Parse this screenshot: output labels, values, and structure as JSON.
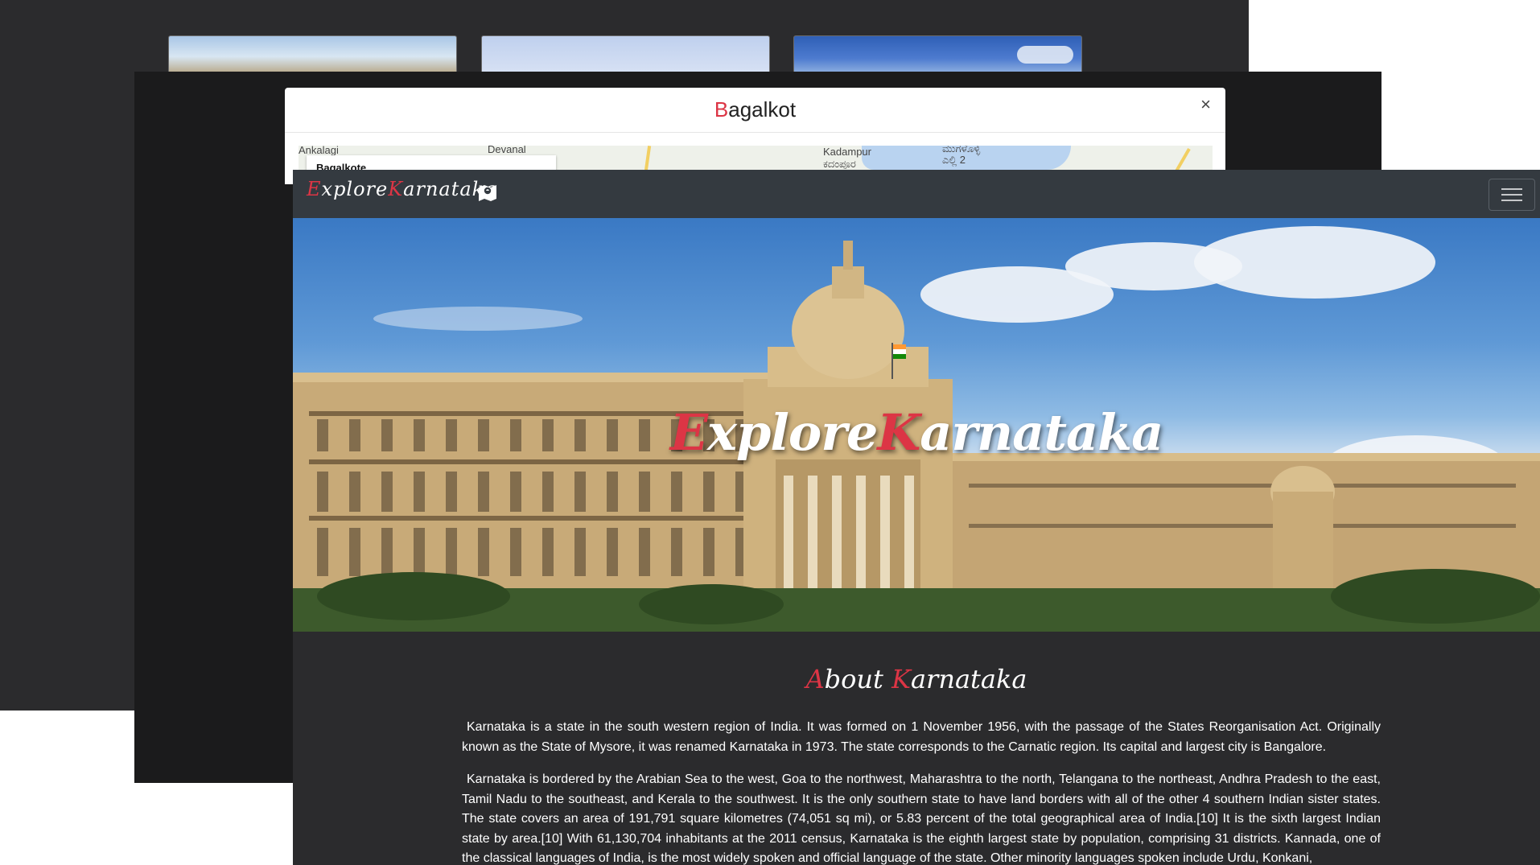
{
  "modal": {
    "title_first": "B",
    "title_rest": "agalkot",
    "close": "×",
    "map": {
      "place_1": "Ankalagi",
      "place_2": "Devanal",
      "place_3": "Kadampur",
      "place_3_kn": "ಕದಂಪೂರ",
      "place_4_kn": "ಮುಗಳೊಳ್ಳಿ",
      "place_5_kn": "ಎಲ್ಲಿ 2",
      "search_text": "Bagalkote"
    }
  },
  "navbar": {
    "brand_e": "E",
    "brand_xplore": "xplore",
    "brand_k": "K",
    "brand_arnataka": "arnataka",
    "map_icon": "map-icon",
    "menu_icon": "hamburger-icon"
  },
  "hero": {
    "title_e": "E",
    "title_xplore": "xplore",
    "title_k": "K",
    "title_arnataka": "arnataka"
  },
  "about": {
    "title_a": "A",
    "title_bout": "bout ",
    "title_k": "K",
    "title_arnataka": "arnataka",
    "paragraph_1": "Karnataka is a state in the south western region of India. It was formed on 1 November 1956, with the passage of the States Reorganisation Act. Originally known as the State of Mysore, it was renamed Karnataka in 1973. The state corresponds to the Carnatic region. Its capital and largest city is Bangalore.",
    "paragraph_2": "Karnataka is bordered by the Arabian Sea to the west, Goa to the northwest, Maharashtra to the north, Telangana to the northeast, Andhra Pradesh to the east, Tamil Nadu to the southeast, and Kerala to the southwest. It is the only southern state to have land borders with all of the other 4 southern Indian sister states. The state covers an area of 191,791 square kilometres (74,051 sq mi), or 5.83 percent of the total geographical area of India.[10] It is the sixth largest Indian state by area.[10] With 61,130,704 inhabitants at the 2011 census, Karnataka is the eighth largest state by population, comprising 31 districts. Kannada, one of the classical languages of India, is the most widely spoken and official language of the state. Other minority languages spoken include Urdu, Konkani,"
  },
  "colors": {
    "accent": "#dc3545",
    "navbar": "#343a40",
    "page_bg": "#2b2b2d"
  }
}
